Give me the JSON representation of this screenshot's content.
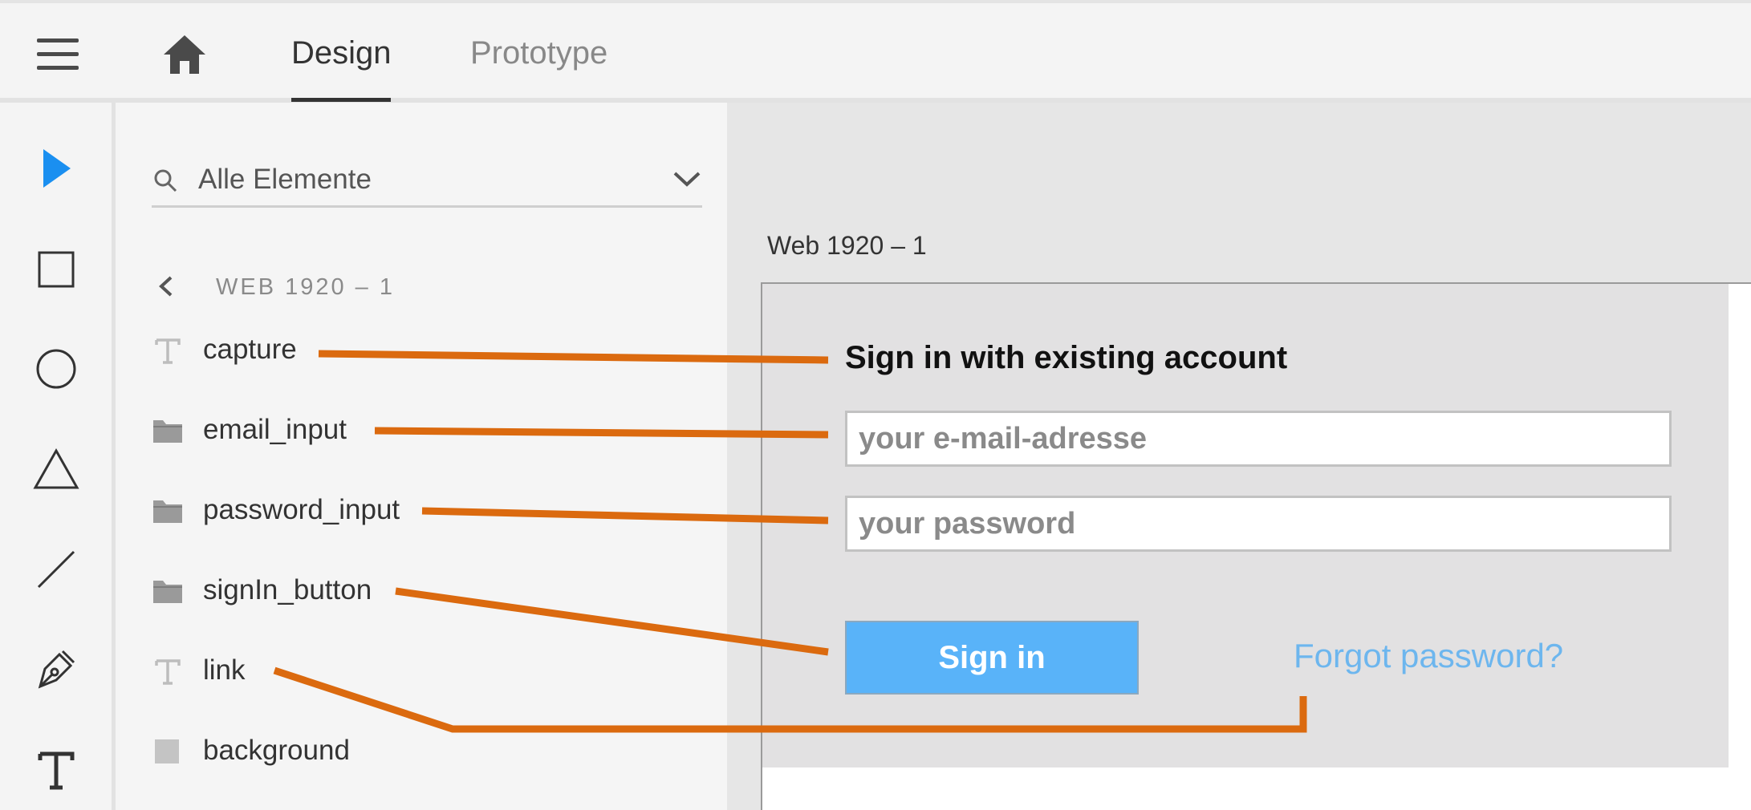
{
  "topbar": {
    "tabs": [
      {
        "label": "Design",
        "active": true
      },
      {
        "label": "Prototype",
        "active": false
      }
    ]
  },
  "icons": {
    "menu": "hamburger-icon",
    "home": "home-icon",
    "tools": [
      "select-arrow-icon",
      "rectangle-tool-icon",
      "ellipse-tool-icon",
      "triangle-tool-icon",
      "line-tool-icon",
      "pen-tool-icon",
      "text-tool-icon"
    ]
  },
  "layers_panel": {
    "search": {
      "value": "Alle Elemente"
    },
    "breadcrumb": "WEB 1920 – 1",
    "items": [
      {
        "name": "capture",
        "type": "text"
      },
      {
        "name": "email_input",
        "type": "folder"
      },
      {
        "name": "password_input",
        "type": "folder"
      },
      {
        "name": "signIn_button",
        "type": "folder"
      },
      {
        "name": "link",
        "type": "text"
      },
      {
        "name": "background",
        "type": "rectangle"
      }
    ]
  },
  "canvas": {
    "artboard_title": "Web 1920 – 1",
    "form": {
      "heading": "Sign in with existing account",
      "email_placeholder": "your e-mail-adresse",
      "password_placeholder": "your password",
      "signin_label": "Sign in",
      "forgot_label": "Forgot password?"
    }
  },
  "colors": {
    "accent": "#1a8ff0",
    "button": "#59b3f9",
    "link": "#6db6ee",
    "annotation": "#db6a0f"
  }
}
